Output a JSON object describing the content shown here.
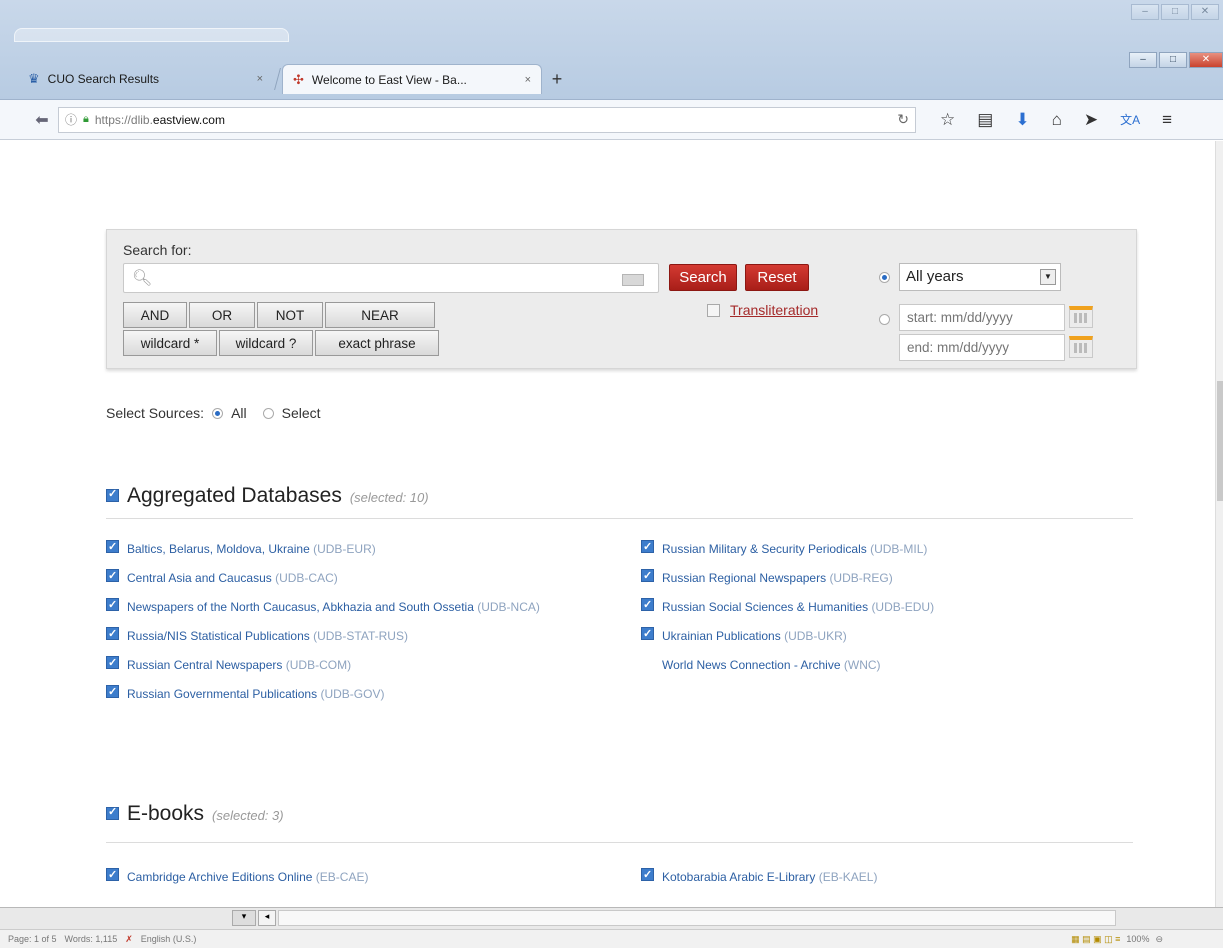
{
  "browser": {
    "tabs": [
      {
        "label": "CUO Search Results",
        "close": "×",
        "active": false
      },
      {
        "label": "Welcome to East View - Ba...",
        "close": "×",
        "active": true
      }
    ],
    "new_tab": "+",
    "url_prefix": "https://dlib.",
    "url_domain": "eastview.com",
    "window_controls": [
      "–",
      "□",
      "✕"
    ]
  },
  "search": {
    "label": "Search for:",
    "query": "",
    "search_button": "Search",
    "reset_button": "Reset",
    "operators": [
      "AND",
      "OR",
      "NOT",
      "NEAR"
    ],
    "wildcards": [
      "wildcard *",
      "wildcard ?",
      "exact phrase"
    ],
    "transliteration": "Transliteration",
    "year_option": "All years",
    "start_placeholder": "start: mm/dd/yyyy",
    "end_placeholder": "end: mm/dd/yyyy"
  },
  "sources": {
    "label": "Select Sources:",
    "all": "All",
    "select": "Select",
    "selected": "All"
  },
  "sections": [
    {
      "title": "Aggregated Databases",
      "selected": "(selected: 10)",
      "left": [
        {
          "name": "Baltics, Belarus, Moldova, Ukraine",
          "code": "(UDB-EUR)"
        },
        {
          "name": "Central Asia and Caucasus",
          "code": "(UDB-CAC)"
        },
        {
          "name": "Newspapers of the North Caucasus, Abkhazia and South Ossetia",
          "code": "(UDB-NCA)"
        },
        {
          "name": "Russia/NIS Statistical Publications",
          "code": "(UDB-STAT-RUS)"
        },
        {
          "name": "Russian Central Newspapers",
          "code": "(UDB-COM)"
        },
        {
          "name": "Russian Governmental Publications",
          "code": "(UDB-GOV)"
        }
      ],
      "right": [
        {
          "name": "Russian Military & Security Periodicals",
          "code": "(UDB-MIL)"
        },
        {
          "name": "Russian Regional Newspapers",
          "code": "(UDB-REG)"
        },
        {
          "name": "Russian Social Sciences & Humanities",
          "code": "(UDB-EDU)"
        },
        {
          "name": "Ukrainian Publications",
          "code": "(UDB-UKR)"
        },
        {
          "name": "World News Connection - Archive",
          "code": "(WNC)"
        }
      ]
    },
    {
      "title": "E-books",
      "selected": "(selected: 3)",
      "left": [
        {
          "name": "Cambridge Archive Editions Online",
          "code": "(EB-CAE)"
        }
      ],
      "right": [
        {
          "name": "Kotobarabia Arabic E-Library",
          "code": "(EB-KAEL)"
        }
      ]
    }
  ],
  "statusbar": {
    "page": "Page: 1 of 5",
    "words": "Words: 1,115",
    "lang": "English (U.S.)",
    "zoom": "100%"
  },
  "colors": {
    "accent_red": "#b8271f",
    "link_blue": "#2c5fa3",
    "checkbox_blue": "#3d7dcc"
  }
}
